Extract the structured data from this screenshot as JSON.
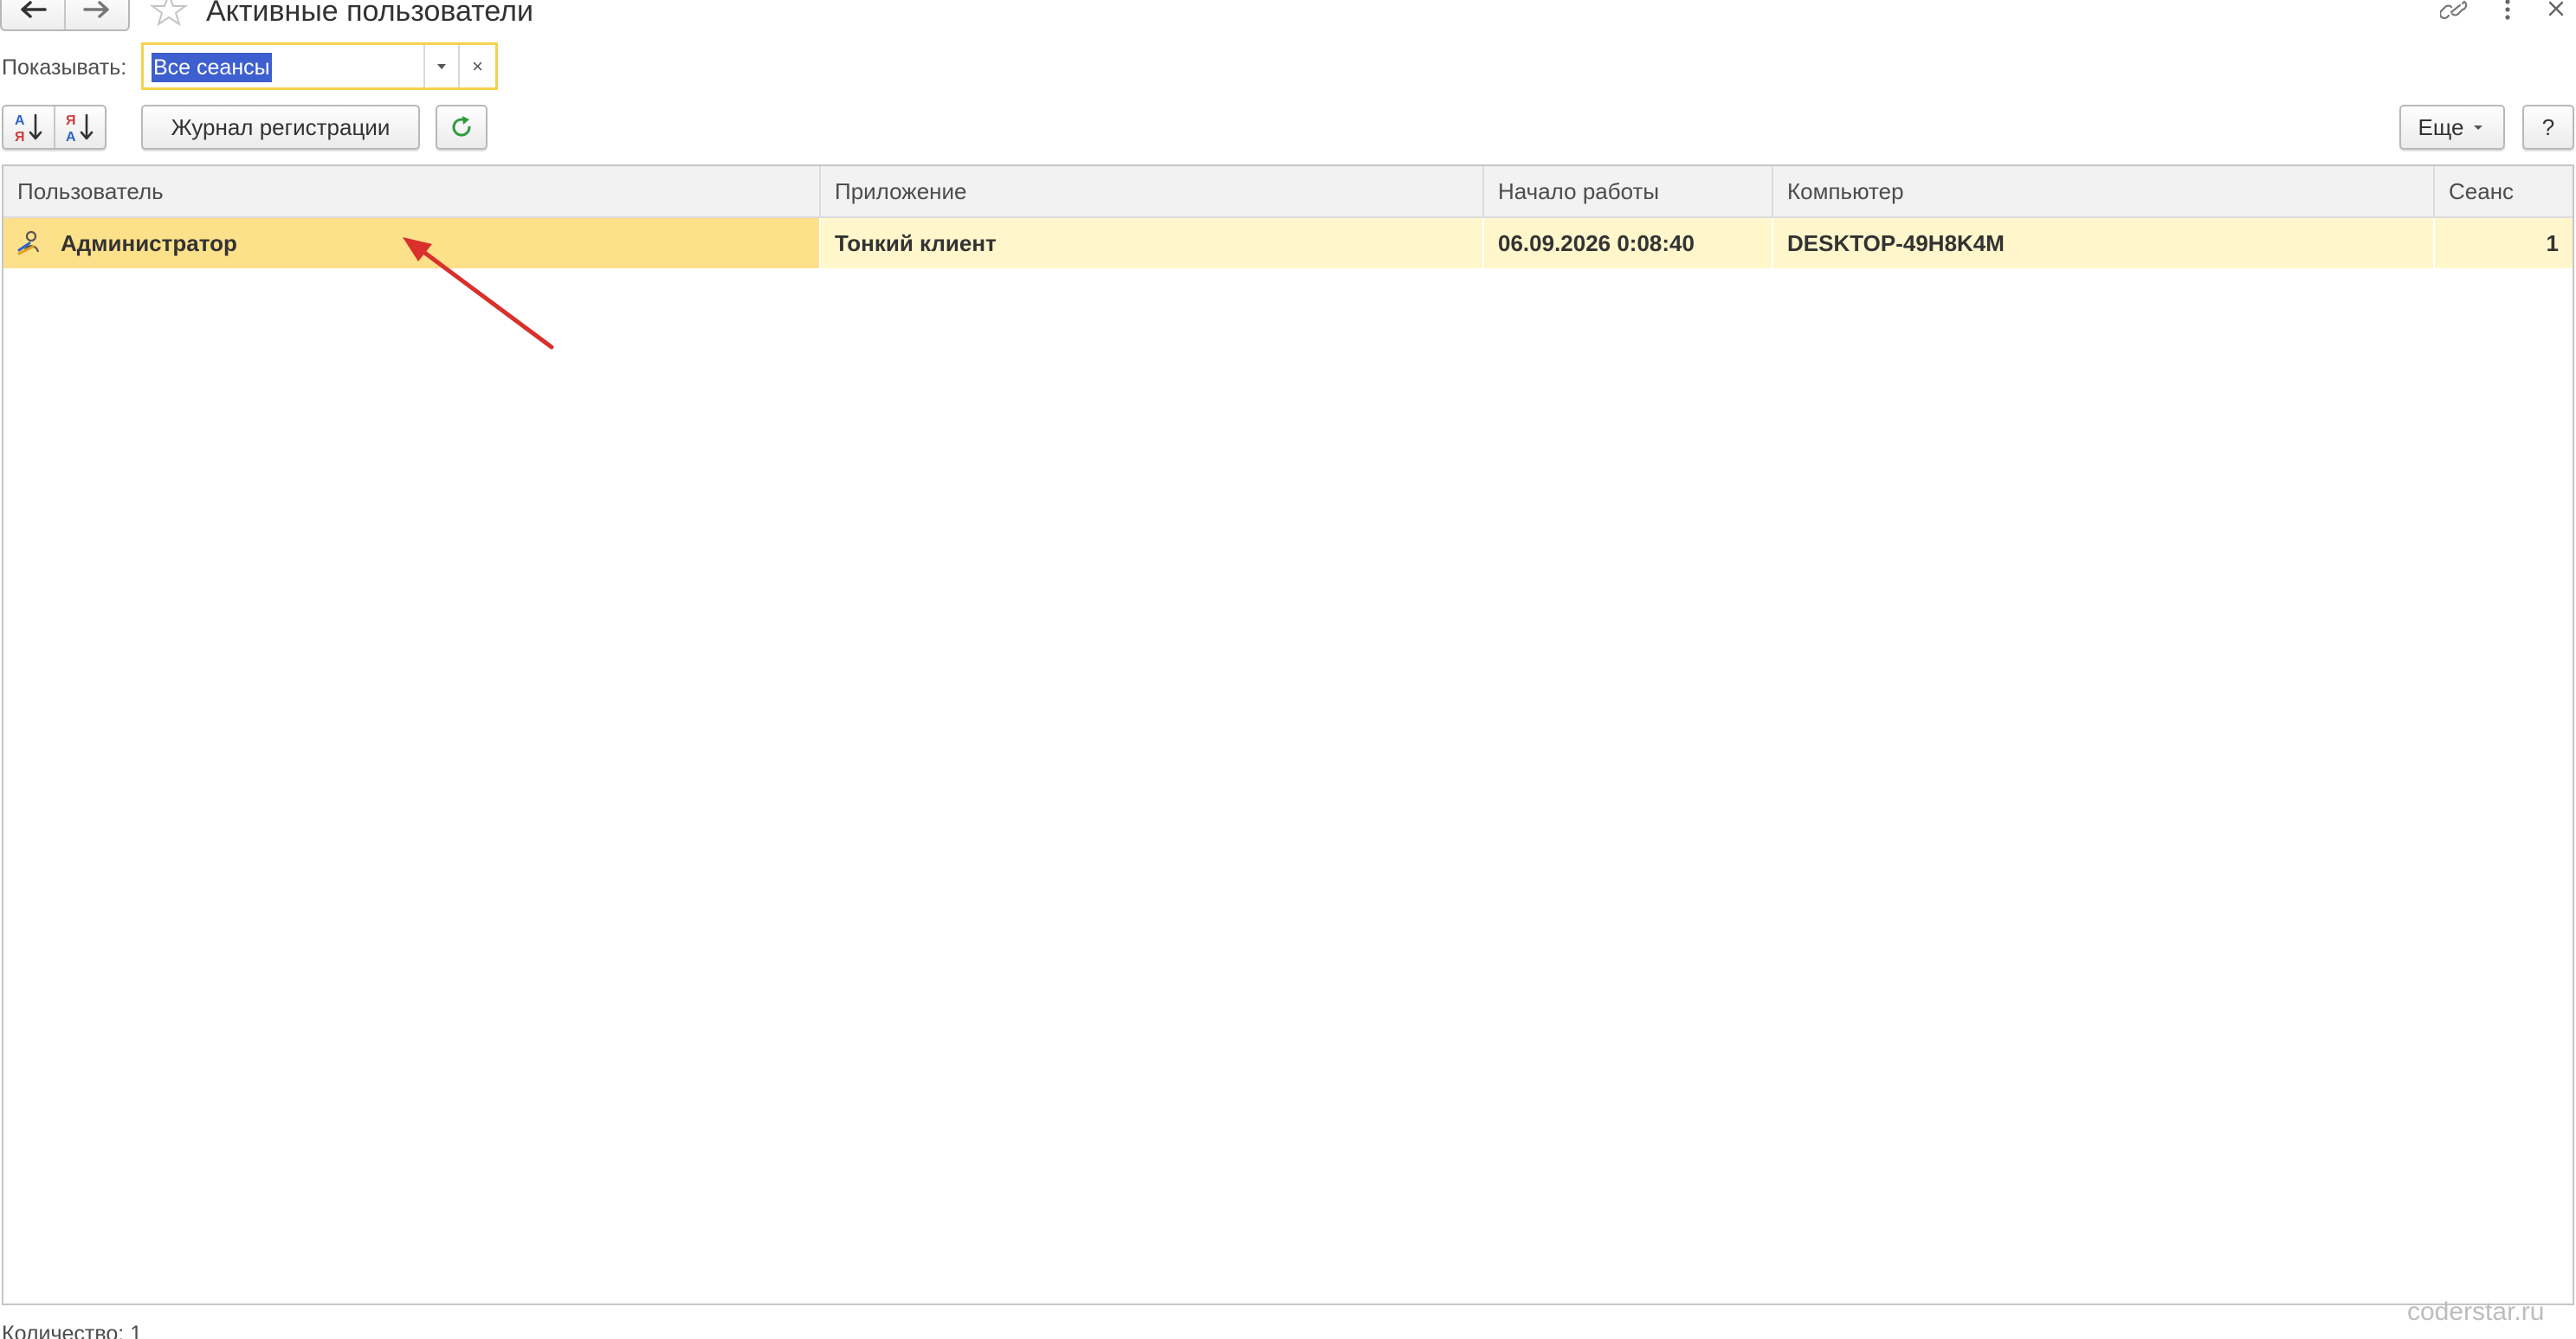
{
  "window": {
    "title": "Активные пользователи"
  },
  "filter": {
    "label": "Показывать:",
    "value": "Все сеансы"
  },
  "toolbar": {
    "journal_label": "Журнал регистрации",
    "more_label": "Еще",
    "help_label": "?"
  },
  "table": {
    "columns": [
      "Пользователь",
      "Приложение",
      "Начало работы",
      "Компьютер",
      "Сеанс"
    ],
    "rows": [
      {
        "user": "Администратор",
        "application": "Тонкий клиент",
        "start": "06.09.2026 0:08:40",
        "computer": "DESKTOP-49H8K4M",
        "session": "1"
      }
    ]
  },
  "footer": {
    "count": "Количество:  1",
    "watermark": "coderstar.ru"
  },
  "colors": {
    "selected_row": "#fff6cc",
    "current_cell": "#fde08a",
    "focus_border": "#f3d34e",
    "selection": "#3d5fcf",
    "annotation_arrow": "#d9302b"
  },
  "icons": {
    "back": "arrow-left-icon",
    "forward": "arrow-right-icon",
    "favorite": "star-icon",
    "link": "link-icon",
    "menu": "kebab-menu-icon",
    "close": "close-icon",
    "sort_asc": "sort-ascending-icon",
    "sort_desc": "sort-descending-icon",
    "refresh": "refresh-icon",
    "user": "user-session-icon"
  }
}
